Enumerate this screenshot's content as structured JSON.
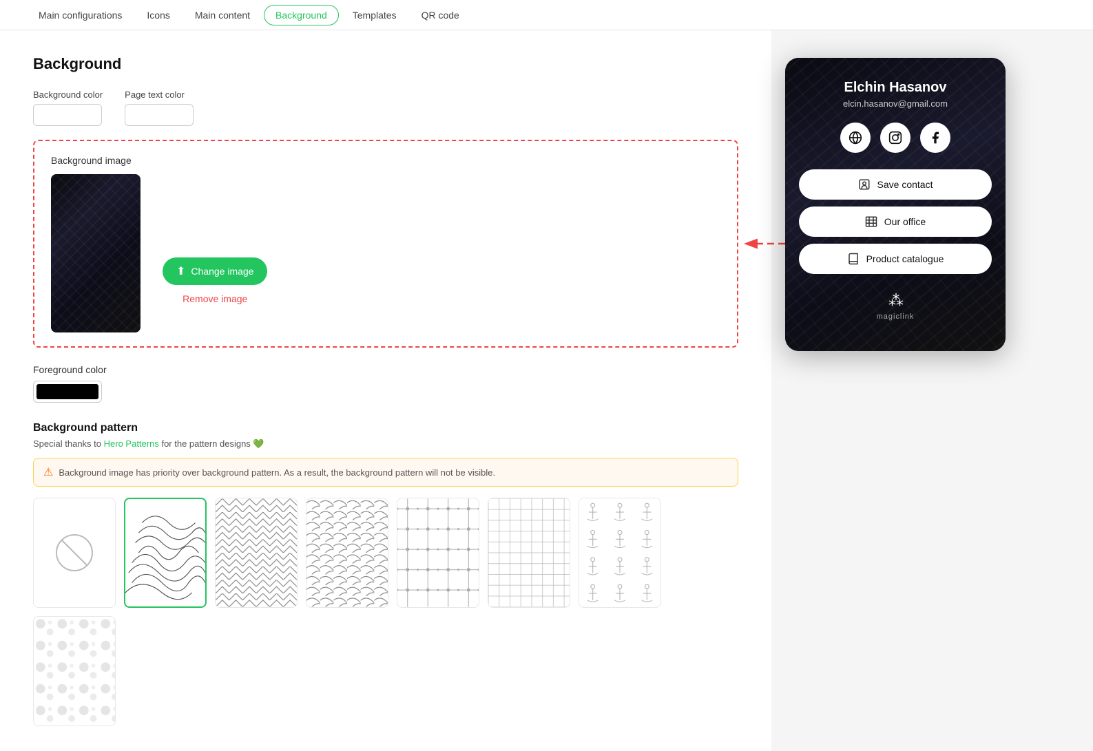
{
  "tabs": [
    {
      "id": "main-configurations",
      "label": "Main configurations",
      "active": false
    },
    {
      "id": "icons",
      "label": "Icons",
      "active": false
    },
    {
      "id": "main-content",
      "label": "Main content",
      "active": false
    },
    {
      "id": "background",
      "label": "Background",
      "active": true
    },
    {
      "id": "templates",
      "label": "Templates",
      "active": false
    },
    {
      "id": "qr-code",
      "label": "QR code",
      "active": false
    }
  ],
  "section": {
    "title": "Background",
    "bg_color_label": "Background color",
    "text_color_label": "Page text color",
    "bg_image_label": "Background image",
    "change_image_btn": "Change image",
    "remove_image_btn": "Remove image",
    "fg_color_label": "Foreground color",
    "pattern_title": "Background pattern",
    "pattern_credit_text": "Special thanks to ",
    "pattern_credit_link": "Hero Patterns",
    "pattern_credit_suffix": " for the pattern designs 💚",
    "warning_text": "Background image has priority over background pattern. As a result, the background pattern will not be visible."
  },
  "card": {
    "name": "Elchin Hasanov",
    "email": "elcin.hasanov@gmail.com",
    "save_contact": "Save contact",
    "our_office": "Our office",
    "product_catalogue": "Product catalogue",
    "footer_brand": "magiclink"
  }
}
